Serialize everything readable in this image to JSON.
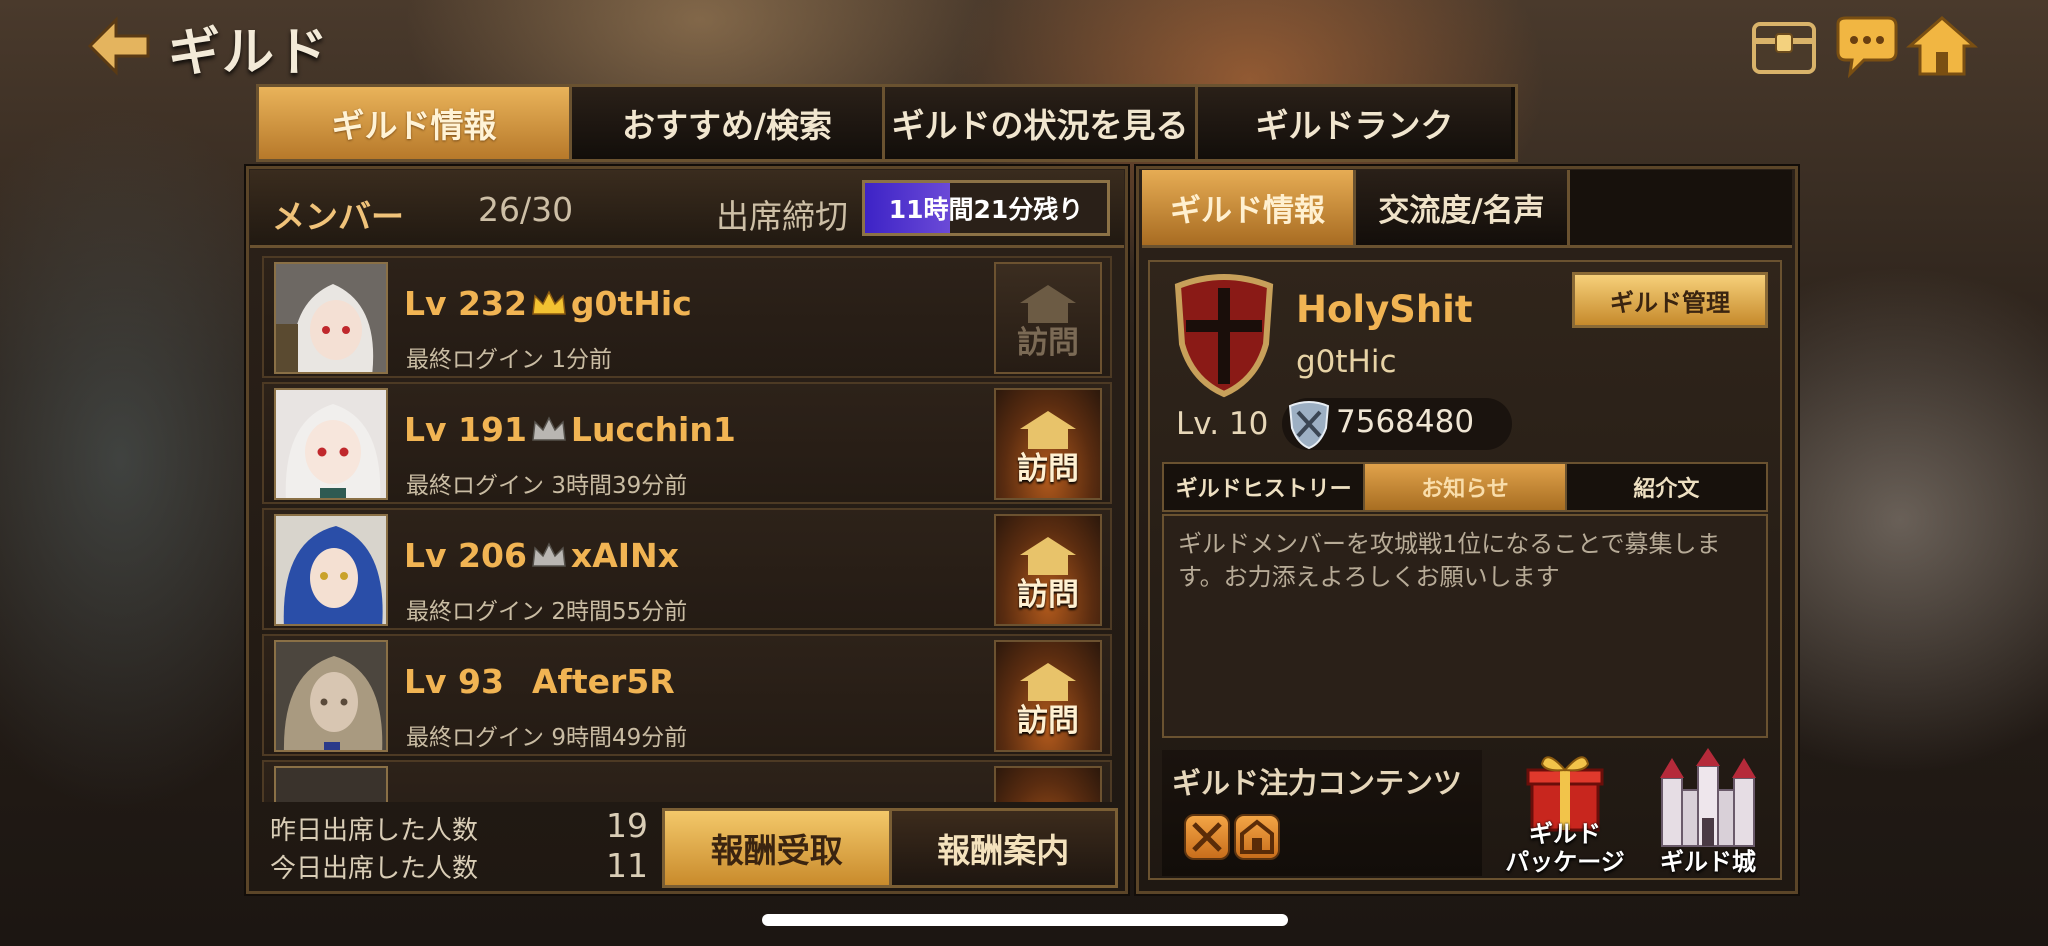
{
  "header": {
    "title": "ギルド",
    "icons": [
      "back-arrow-icon",
      "treasure-chest-icon",
      "chat-icon",
      "home-icon"
    ]
  },
  "tabs": [
    {
      "label": "ギルド情報",
      "active": true
    },
    {
      "label": "おすすめ/検索",
      "active": false
    },
    {
      "label": "ギルドの状況を見る",
      "active": false
    },
    {
      "label": "ギルドランク",
      "active": false
    }
  ],
  "members_panel": {
    "member_label": "メンバー",
    "member_count": "26/30",
    "deadline_label": "出席締切",
    "deadline_remaining": "11時間21分残り",
    "deadline_progress": 0.35,
    "members": [
      {
        "level": "Lv 232",
        "crown": "gold",
        "name": "g0tHic",
        "last_login_label": "最終ログイン",
        "last_login": "1分前",
        "visit_label": "訪問",
        "visit_enabled": false
      },
      {
        "level": "Lv 191",
        "crown": "silver",
        "name": "Lucchin1",
        "last_login_label": "最終ログイン",
        "last_login": "3時間39分前",
        "visit_label": "訪問",
        "visit_enabled": true
      },
      {
        "level": "Lv 206",
        "crown": "silver",
        "name": "xAINx",
        "last_login_label": "最終ログイン",
        "last_login": "2時間55分前",
        "visit_label": "訪問",
        "visit_enabled": true
      },
      {
        "level": "Lv 93",
        "crown": "none",
        "name": "After5R",
        "last_login_label": "最終ログイン",
        "last_login": "9時間49分前",
        "visit_label": "訪問",
        "visit_enabled": true
      }
    ],
    "attendance": {
      "yesterday_label": "昨日出席した人数",
      "yesterday_count": "19",
      "today_label": "今日出席した人数",
      "today_count": "11"
    },
    "reward_claim_label": "報酬受取",
    "reward_info_label": "報酬案内"
  },
  "info_panel": {
    "tabs": [
      {
        "label": "ギルド情報",
        "active": true
      },
      {
        "label": "交流度/名声",
        "active": false
      }
    ],
    "guild_name": "HolyShit",
    "guild_master": "g0tHic",
    "manage_label": "ギルド管理",
    "guild_level": "Lv. 10",
    "guild_power": "7568480",
    "sub_tabs": [
      {
        "label": "ギルドヒストリー",
        "active": false
      },
      {
        "label": "お知らせ",
        "active": true
      },
      {
        "label": "紹介文",
        "active": false
      }
    ],
    "notice_text": "ギルドメンバーを攻城戦1位になることで募集します。お力添えよろしくお願いします",
    "focus_label": "ギルド注力コンテンツ",
    "focus_icons": [
      "crossed-swords-icon",
      "shop-icon"
    ],
    "package_label_line1": "ギルド",
    "package_label_line2": "パッケージ",
    "castle_label": "ギルド城"
  },
  "colors": {
    "accent_gold": "#f1b453",
    "tab_active": "#e9b35a",
    "deadline_bar": "#3d23c6"
  }
}
